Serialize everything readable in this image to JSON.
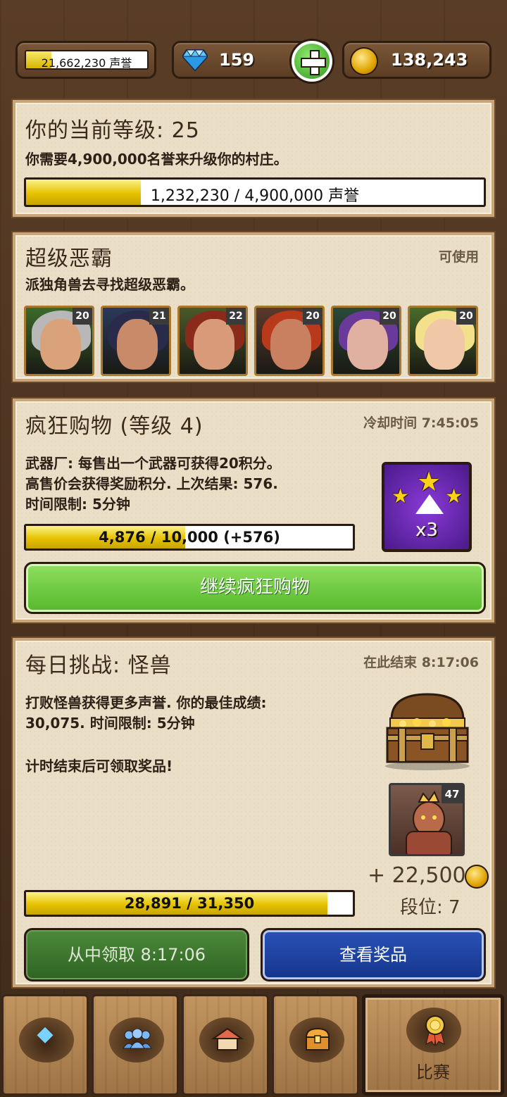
{
  "topbar": {
    "reputation": "21,662,230 声誉",
    "reputation_progress": 0.21,
    "gems": "159",
    "gold": "138,243"
  },
  "level_panel": {
    "title": "你的当前等级: 25",
    "description": "你需要4,900,000名誉来升级你的村庄。",
    "progress_text": "1,232,230 / 4,900,000 声誉",
    "progress": 0.2515
  },
  "bully_panel": {
    "title": "超级恶霸",
    "status": "可使用",
    "description": "派独角兽去寻找超级恶霸。",
    "heroes": [
      {
        "level": "20",
        "name": "hero-grey-haired-man"
      },
      {
        "level": "21",
        "name": "hero-dark-haired-woman"
      },
      {
        "level": "22",
        "name": "hero-red-bearded-warrior"
      },
      {
        "level": "20",
        "name": "hero-red-dwarf"
      },
      {
        "level": "20",
        "name": "hero-purple-elf"
      },
      {
        "level": "20",
        "name": "hero-blonde-elf"
      }
    ]
  },
  "shopping_panel": {
    "title": "疯狂购物 (等级 4)",
    "cooldown": "冷却时间 7:45:05",
    "description_line1": "武器厂: 每售出一个武器可获得20积分。",
    "description_line2": "高售价会获得奖励积分. 上次结果: 576.",
    "description_line3": "时间限制: 5分钟",
    "progress_text": "4,876 / 10,000 (+576)",
    "progress": 0.4876,
    "boost_label": "x3",
    "button_label": "继续疯狂购物"
  },
  "challenge_panel": {
    "title": "每日挑战: 怪兽",
    "ends": "在此结束 8:17:06",
    "description_line1": "打败怪兽获得更多声誉. 你的最佳成绩:",
    "description_line2": "30,075. 时间限制: 5分钟",
    "description_line3": "计时结束后可领取奖品!",
    "monster_level": "47",
    "reward": "+ 22,500",
    "rank": "段位: 7",
    "progress_text": "28,891 / 31,350",
    "progress": 0.9216,
    "claim_label": "从中领取 8:17:06",
    "rewards_label": "查看奖品"
  },
  "nav": {
    "items": [
      {
        "icon": "gem-icon",
        "label": ""
      },
      {
        "icon": "people-icon",
        "label": ""
      },
      {
        "icon": "house-icon",
        "label": ""
      },
      {
        "icon": "chest-icon",
        "label": ""
      },
      {
        "icon": "medal-icon",
        "label": "比赛"
      }
    ]
  },
  "colors": {
    "panel_bg": "#eadfc6",
    "bar_fill": "#e6c200",
    "green_button": "#55b82c",
    "blue_button": "#15358a",
    "wood": "#5a3d26"
  }
}
